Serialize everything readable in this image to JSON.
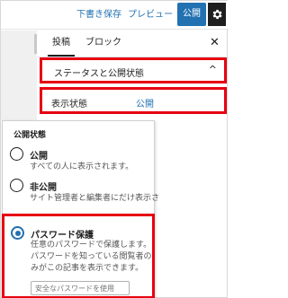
{
  "toolbar": {
    "save_draft": "下書き保存",
    "preview": "プレビュー",
    "publish": "公開",
    "settings_icon": "gear-icon",
    "more_icon": "more-vertical-icon"
  },
  "sidebar": {
    "tabs": [
      {
        "label": "投稿",
        "active": true
      },
      {
        "label": "ブロック",
        "active": false
      }
    ],
    "close_icon": "close-icon",
    "panel_title": "ステータスと公開状態",
    "visibility_label": "表示状態",
    "visibility_value": "公開"
  },
  "popover": {
    "title": "公開状態",
    "options": [
      {
        "label": "公開",
        "description": "すべての人に表示されます。",
        "checked": false
      },
      {
        "label": "非公開",
        "description": "サイト管理者と編集者にだけ表示さ",
        "checked": false
      },
      {
        "label": "パスワード保護",
        "description": "任意のパスワードで保護します。パスワードを知っている閲覧者のみがこの記事を表示できます。",
        "checked": true
      }
    ],
    "password_placeholder": "安全なパスワードを使用"
  },
  "colors": {
    "accent": "#2271b1",
    "highlight": "#e60012"
  }
}
